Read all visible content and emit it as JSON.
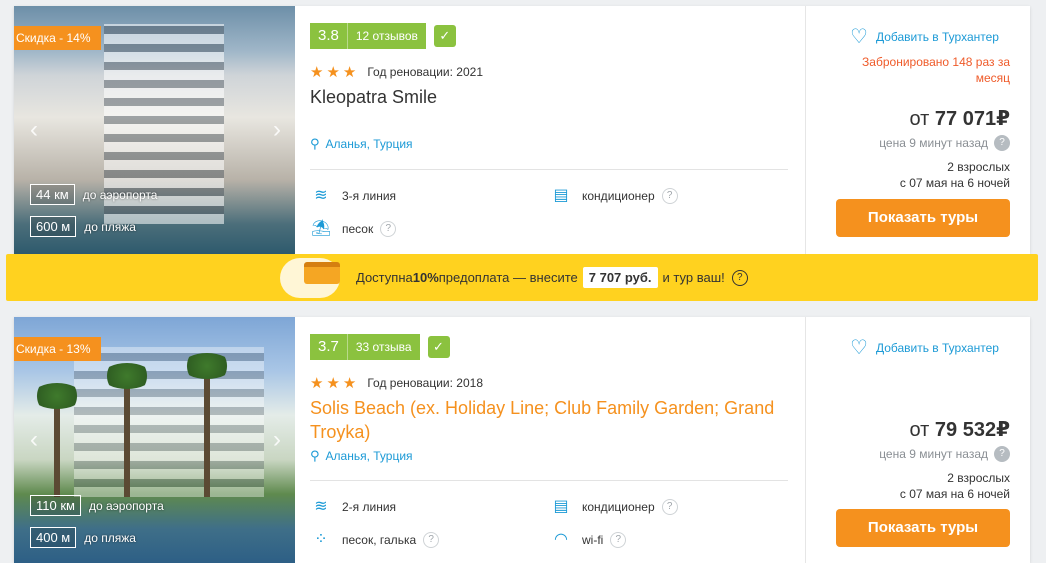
{
  "colors": {
    "accent": "#f5911e",
    "rating": "#8bc23f",
    "link": "#1c9ad6",
    "promo": "#ffd21f",
    "booked": "#ef5b2a"
  },
  "hotels": [
    {
      "discount": "Скидка - 14%",
      "score": "3.8",
      "reviews": "12 отзывов",
      "stars": "★★★",
      "renovation": "Год реновации: 2021",
      "name": "Kleopatra Smile",
      "location": "Аланья, Турция",
      "dist_airport": "44 км",
      "dist_airport_label": "до аэропорта",
      "dist_beach": "600 м",
      "dist_beach_label": "до пляжа",
      "features": [
        {
          "icon": "wave-icon",
          "label": "3-я линия"
        },
        {
          "icon": "ac-icon",
          "label": "кондиционер"
        },
        {
          "icon": "beach-icon",
          "label": "песок"
        }
      ],
      "favorite": "Добавить в Турхантер",
      "booked": "Забронировано 148 раз за месяц",
      "price": "77 071",
      "price_prefix": "от",
      "currency": "₽",
      "price_ago": "цена 9 минут назад",
      "pax": "2 взрослых",
      "dates": "с 07 мая на 6 ночей",
      "button": "Показать туры"
    },
    {
      "discount": "Скидка - 13%",
      "score": "3.7",
      "reviews": "33 отзыва",
      "stars": "★★★",
      "renovation": "Год реновации: 2018",
      "name": "Solis Beach (ex. Holiday Line; Club Family Garden; Grand Troyka)",
      "location": "Аланья, Турция",
      "dist_airport": "110 км",
      "dist_airport_label": "до аэропорта",
      "dist_beach": "400 м",
      "dist_beach_label": "до пляжа",
      "features": [
        {
          "icon": "wave-icon",
          "label": "2-я линия"
        },
        {
          "icon": "ac-icon",
          "label": "кондиционер"
        },
        {
          "icon": "pebbles-icon",
          "label": "песок, галька"
        },
        {
          "icon": "wifi-icon",
          "label": "wi-fi"
        }
      ],
      "favorite": "Добавить в Турхантер",
      "price": "79 532",
      "price_prefix": "от",
      "currency": "₽",
      "price_ago": "цена 9 минут назад",
      "pax": "2 взрослых",
      "dates": "с 07 мая на 6 ночей",
      "button": "Показать туры"
    }
  ],
  "promo": {
    "text_before": "Доступна ",
    "percent": "10%",
    "text_mid": " предоплата — внесите",
    "amount": "7 707 руб.",
    "text_after": "и тур ваш!"
  }
}
